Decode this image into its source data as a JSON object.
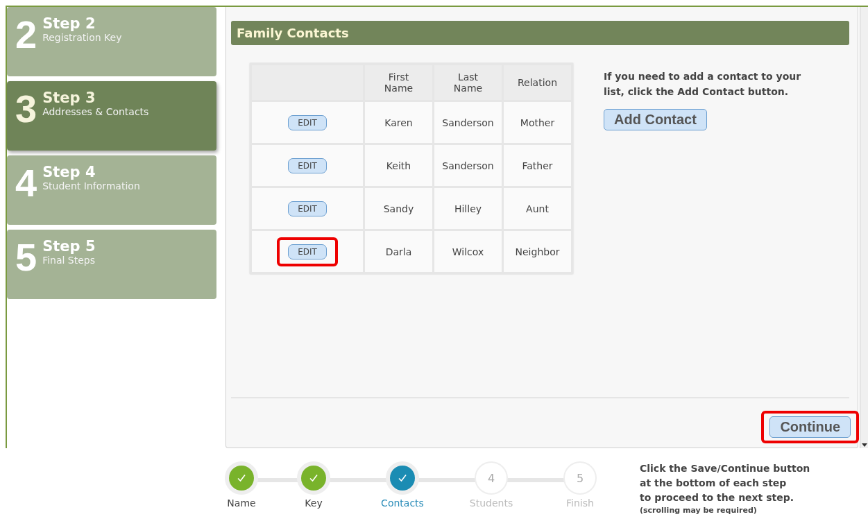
{
  "sidebar": {
    "items": [
      {
        "number": "2",
        "title": "Step 2",
        "subtitle": "Registration Key",
        "selected": false
      },
      {
        "number": "3",
        "title": "Step 3",
        "subtitle": "Addresses & Contacts",
        "selected": true
      },
      {
        "number": "4",
        "title": "Step 4",
        "subtitle": "Student Information",
        "selected": false
      },
      {
        "number": "5",
        "title": "Step 5",
        "subtitle": "Final Steps",
        "selected": false
      }
    ]
  },
  "panel": {
    "title": "Family Contacts",
    "table": {
      "columns": [
        "First Name",
        "Last Name",
        "Relation"
      ],
      "rows": [
        {
          "action": "EDIT",
          "cells": [
            "Karen",
            "Sanderson",
            "Mother"
          ],
          "highlighted": false
        },
        {
          "action": "EDIT",
          "cells": [
            "Keith",
            "Sanderson",
            "Father"
          ],
          "highlighted": false
        },
        {
          "action": "EDIT",
          "cells": [
            "Sandy",
            "Hilley",
            "Aunt"
          ],
          "highlighted": false
        },
        {
          "action": "EDIT",
          "cells": [
            "Darla",
            "Wilcox",
            "Neighbor"
          ],
          "highlighted": true
        }
      ]
    },
    "hint": "If you need to add a contact to your list, click the Add Contact button.",
    "add_button": "Add Contact",
    "continue_button": {
      "label": "Continue",
      "highlighted": true
    }
  },
  "progress": {
    "steps": [
      {
        "kind": "done",
        "label": "Name"
      },
      {
        "kind": "done",
        "label": "Key"
      },
      {
        "kind": "current",
        "label": "Contacts"
      },
      {
        "kind": "pending",
        "number": "4",
        "label": "Students"
      },
      {
        "kind": "pending",
        "number": "5",
        "label": "Finish"
      }
    ],
    "note_lines": [
      "Click the Save/Continue button",
      "at the bottom of each step",
      "to proceed to the next step."
    ],
    "note_small": "(scrolling may be required)"
  }
}
